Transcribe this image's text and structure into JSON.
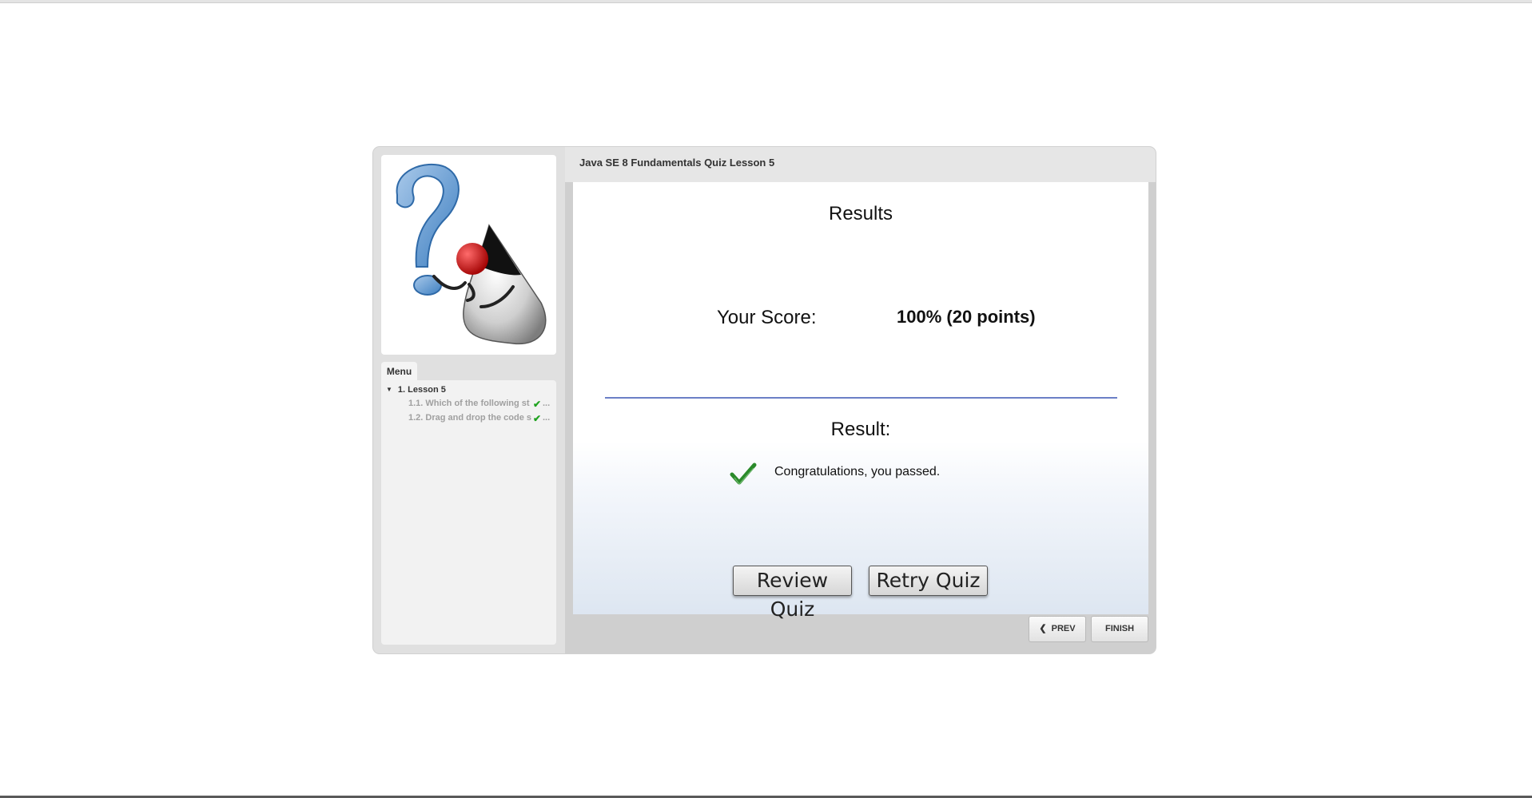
{
  "quiz": {
    "title": "Java SE 8 Fundamentals Quiz Lesson 5"
  },
  "sidebar": {
    "menu_tab": "Menu",
    "lesson": "1. Lesson 5",
    "items": [
      {
        "label": "1.1. Which of the following st",
        "status": "completed"
      },
      {
        "label": "1.2. Drag and drop the code s",
        "status": "completed"
      }
    ]
  },
  "results": {
    "heading": "Results",
    "score_label": "Your Score:",
    "score_value": "100% (20 points)",
    "result_label": "Result:",
    "message": "Congratulations, you passed.",
    "review_button": "Review Quiz",
    "retry_button": "Retry Quiz"
  },
  "nav": {
    "prev": "PREV",
    "finish": "FINISH"
  },
  "colors": {
    "check": "#2a8a2a",
    "divider": "#6b7fc6"
  }
}
